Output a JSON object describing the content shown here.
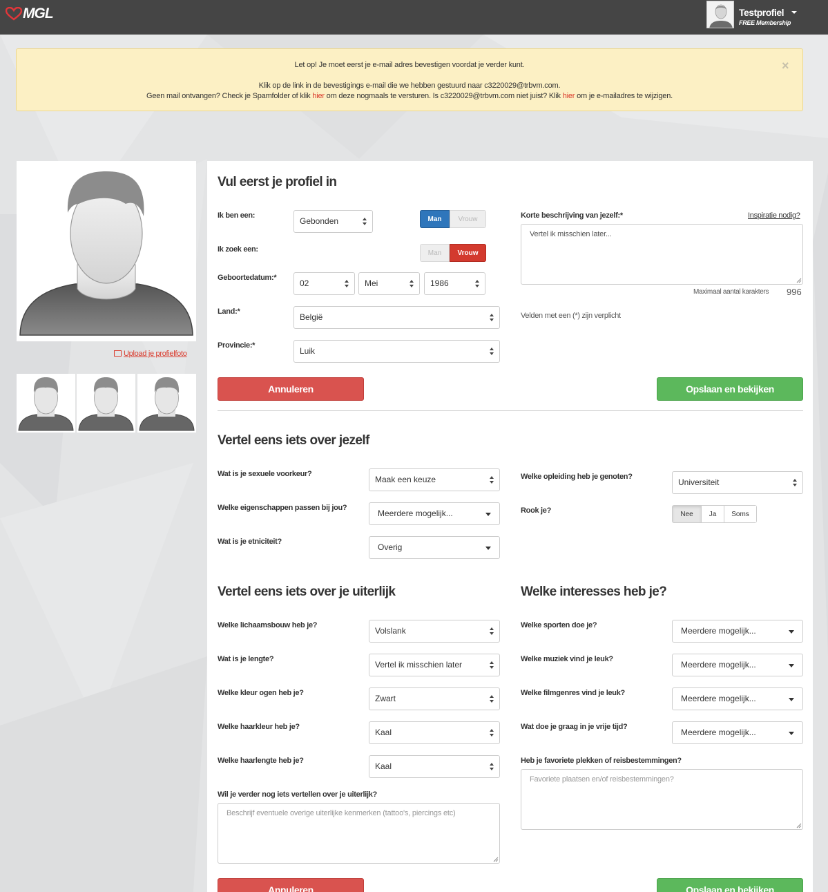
{
  "header": {
    "logo_text": "MGL",
    "profile_name": "Testprofiel",
    "membership": "FREE Membership"
  },
  "alert": {
    "line1": "Let op! Je moet eerst je e-mail adres bevestigen voordat je verder kunt.",
    "line2": "Klik op de link in de bevestigings e-mail die we hebben gestuurd naar c3220029@trbvm.com.",
    "line3_a": "Geen mail ontvangen? Check je Spamfolder of klik ",
    "line3_link1": "hier",
    "line3_b": " om deze nogmaals te versturen. Is c3220029@trbvm.com niet juist? Klik ",
    "line3_link2": "hier",
    "line3_c": " om je e-mailadres te wijzigen.",
    "close": "×"
  },
  "sidebar": {
    "upload_label": "Upload je profielfoto"
  },
  "section_profile": {
    "title": "Vul eerst je profiel in",
    "i_am_label": "Ik ben een:",
    "i_am_value": "Gebonden",
    "gender_man": "Man",
    "gender_vrouw": "Vrouw",
    "seeking_label": "Ik zoek een:",
    "seek_man": "Man",
    "seek_vrouw": "Vrouw",
    "birthdate_label": "Geboortedatum:*",
    "birth_day": "02",
    "birth_month": "Mei",
    "birth_year": "1986",
    "country_label": "Land:*",
    "country_value": "België",
    "province_label": "Provincie:*",
    "province_value": "Luik",
    "desc_label": "Korte beschrijving van jezelf:*",
    "inspiration_link": "Inspiratie nodig?",
    "desc_value": "Vertel ik misschien later...",
    "max_chars_label": "Maximaal aantal karakters",
    "max_chars_count": "996",
    "required_note": "Velden met een (*) zijn verplicht",
    "cancel": "Annuleren",
    "save": "Opslaan en bekijken"
  },
  "section_about": {
    "title": "Vertel eens iets over jezelf",
    "pref_label": "Wat is je sexuele voorkeur?",
    "pref_value": "Maak een keuze",
    "traits_label": "Welke eigenschappen passen bij jou?",
    "traits_value": "Meerdere mogelijk...",
    "ethnicity_label": "Wat is je etniciteit?",
    "ethnicity_value": "Overig",
    "education_label": "Welke opleiding heb je genoten?",
    "education_value": "Universiteit",
    "smoke_label": "Rook je?",
    "smoke_options": [
      "Nee",
      "Ja",
      "Soms"
    ]
  },
  "section_looks": {
    "title": "Vertel eens iets over je uiterlijk",
    "build_label": "Welke lichaamsbouw heb je?",
    "build_value": "Volslank",
    "height_label": "Wat is je lengte?",
    "height_value": "Vertel ik misschien later",
    "eyes_label": "Welke kleur ogen heb je?",
    "eyes_value": "Zwart",
    "hair_color_label": "Welke haarkleur heb je?",
    "hair_color_value": "Kaal",
    "hair_length_label": "Welke haarlengte heb je?",
    "hair_length_value": "Kaal",
    "more_label": "Wil je verder nog iets vertellen over je uiterlijk?",
    "more_placeholder": "Beschrijf eventuele overige uiterlijke kenmerken (tattoo's, piercings etc)"
  },
  "section_interests": {
    "title": "Welke interesses heb je?",
    "sports_label": "Welke sporten doe je?",
    "sports_value": "Meerdere mogelijk...",
    "music_label": "Welke muziek vind je leuk?",
    "music_value": "Meerdere mogelijk...",
    "film_label": "Welke filmgenres vind je leuk?",
    "film_value": "Meerdere mogelijk...",
    "free_label": "Wat doe je graag in je vrije tijd?",
    "free_value": "Meerdere mogelijk...",
    "places_label": "Heb je favoriete plekken of reisbestemmingen?",
    "places_placeholder": "Favoriete plaatsen en/of reisbestemmingen?"
  },
  "footer_buttons": {
    "cancel": "Annuleren",
    "save": "Opslaan en bekijken"
  },
  "colors": {
    "topbar": "#454545",
    "brand_red": "#d9392b",
    "primary_blue": "#2f76bb",
    "danger": "#d9534f",
    "success": "#5cb85c",
    "alert_bg": "#fcf0c4"
  }
}
